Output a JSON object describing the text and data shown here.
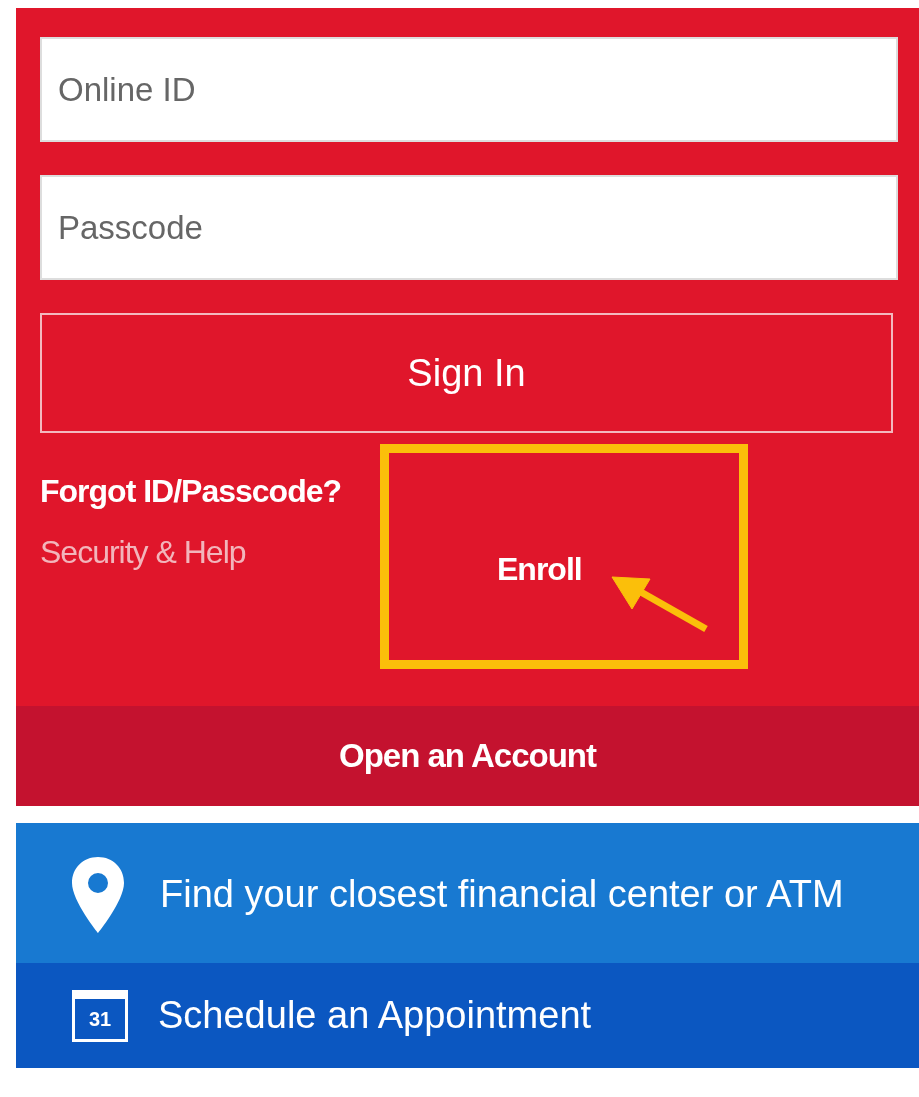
{
  "login": {
    "fields": [
      {
        "placeholder": "Online ID"
      },
      {
        "placeholder": "Passcode"
      }
    ],
    "sign_in": "Sign In",
    "links": [
      {
        "label": "Forgot ID/Passcode?",
        "kind": "primary"
      },
      {
        "label": "Security & Help",
        "kind": "muted"
      }
    ],
    "enroll": {
      "label": "Enroll",
      "highlighted": true
    },
    "open_account": "Open an Account"
  },
  "actions": [
    {
      "kind": "location",
      "label": "Find your closest financial center or ATM"
    },
    {
      "kind": "calendar",
      "label": "Schedule an Appointment",
      "day": "31"
    }
  ]
}
